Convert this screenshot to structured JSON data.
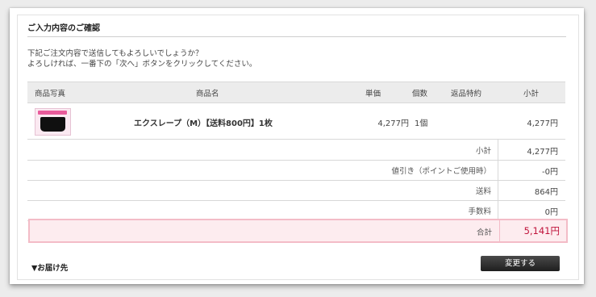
{
  "section_title": "ご入力内容のご確認",
  "intro": {
    "line1": "下記ご注文内容で送信してもよろしいでしょうか？",
    "line2": "よろしければ、一番下の「次へ」ボタンをクリックしてください。"
  },
  "table": {
    "headers": {
      "photo": "商品写真",
      "name": "商品名",
      "price": "単価",
      "qty": "個数",
      "return_policy": "返品特約",
      "subtotal": "小計"
    },
    "items": [
      {
        "name": "エクスレープ（M）【送料800円】1枚",
        "price": "4,277円",
        "qty": "1個",
        "return_policy": "",
        "subtotal": "4,277円"
      }
    ]
  },
  "summary": {
    "subtotal": {
      "label": "小計",
      "value": "4,277円"
    },
    "discount": {
      "label": "値引き（ポイントご使用時）",
      "value": "-0円"
    },
    "shipping": {
      "label": "送料",
      "value": "864円"
    },
    "fee": {
      "label": "手数料",
      "value": "0円"
    },
    "total": {
      "label": "合計",
      "value": "5,141円"
    }
  },
  "delivery_heading": "▼お届け先",
  "change_button": "変更する",
  "colors": {
    "total_text": "#c0143c",
    "total_bg": "#fdecef",
    "total_border": "#f3bcc7",
    "button_bg": "#2b2b2b"
  }
}
